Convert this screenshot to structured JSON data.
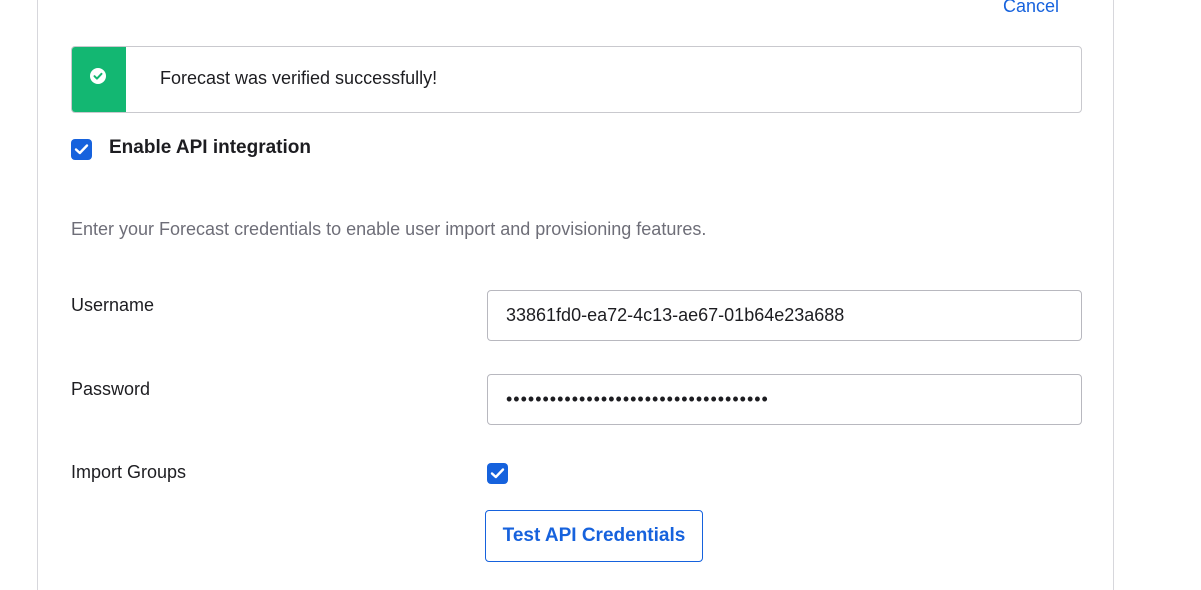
{
  "header": {
    "cancel_label": "Cancel"
  },
  "banner": {
    "message": "Forecast was verified successfully!",
    "status_color": "#13b772"
  },
  "api_integration": {
    "enable_label": "Enable API integration",
    "enabled": true,
    "description": "Enter your Forecast credentials to enable user import and provisioning features."
  },
  "form": {
    "username": {
      "label": "Username",
      "value": "33861fd0-ea72-4c13-ae67-01b64e23a688"
    },
    "password": {
      "label": "Password",
      "value": "••••••••••••••••••••••••••••••••••••"
    },
    "import_groups": {
      "label": "Import Groups",
      "checked": true
    },
    "test_button_label": "Test API Credentials"
  },
  "colors": {
    "accent": "#1662dd",
    "success": "#13b772"
  }
}
